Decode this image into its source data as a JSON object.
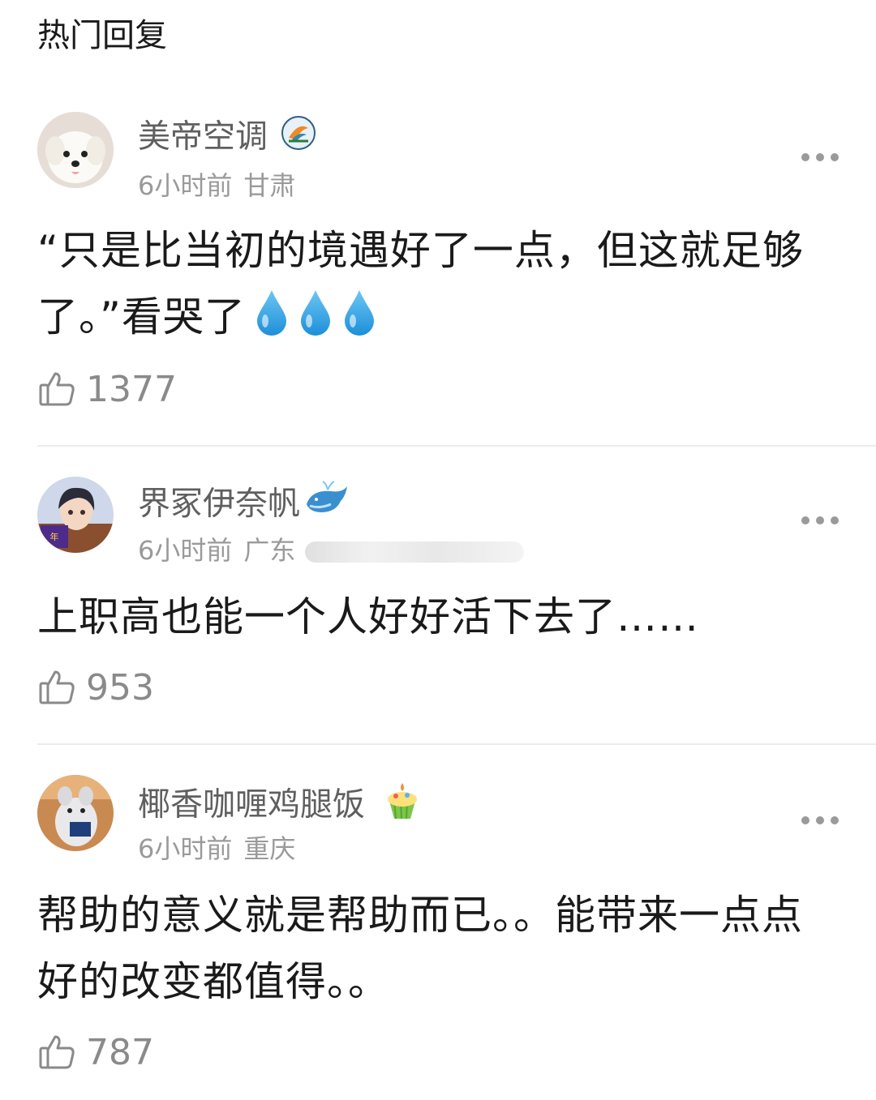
{
  "section_title": "热门回复",
  "comments": [
    {
      "username": "美帝空调",
      "badge_icon": "bird-of-paradise-badge-icon",
      "time": "6小时前",
      "location": "甘肃",
      "text": "“只是比当初的境遇好了一点，但这就足够了。”看哭了",
      "emoji": [
        "droplet-emoji",
        "droplet-emoji",
        "droplet-emoji"
      ],
      "likes": "1377"
    },
    {
      "username": "界冢伊奈帆",
      "badge_icon": "whale-badge-icon",
      "time": "6小时前",
      "location": "广东",
      "text": "上职高也能一个人好好活下去了……",
      "likes": "953"
    },
    {
      "username": "椰香咖喱鸡腿饭",
      "badge_icon": "cupcake-badge-icon",
      "time": "6小时前",
      "location": "重庆",
      "text": "帮助的意义就是帮助而已。。能带来一点点好的改变都值得。。",
      "likes": "787"
    }
  ]
}
